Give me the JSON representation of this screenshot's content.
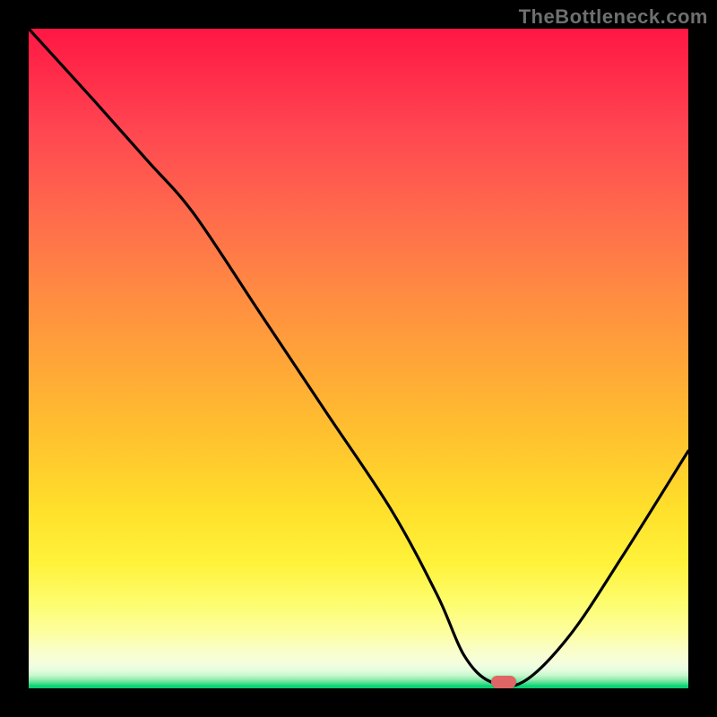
{
  "watermark": "TheBottleneck.com",
  "colors": {
    "frame": "#000000",
    "curve_stroke": "#000000",
    "marker_fill": "#e06666",
    "gradient_top": "#ff1744",
    "gradient_bottom": "#00d070"
  },
  "chart_data": {
    "type": "line",
    "title": "",
    "xlabel": "",
    "ylabel": "",
    "xlim": [
      0,
      100
    ],
    "ylim": [
      0,
      100
    ],
    "grid": false,
    "series": [
      {
        "name": "curve",
        "x": [
          0,
          10,
          18,
          25,
          35,
          45,
          55,
          62,
          66,
          70,
          75,
          82,
          90,
          100
        ],
        "values": [
          100,
          89,
          80,
          72,
          57,
          42,
          27,
          14,
          5,
          1,
          1,
          8,
          20,
          36
        ]
      }
    ],
    "marker": {
      "x": 72,
      "y": 1
    },
    "annotations": []
  }
}
